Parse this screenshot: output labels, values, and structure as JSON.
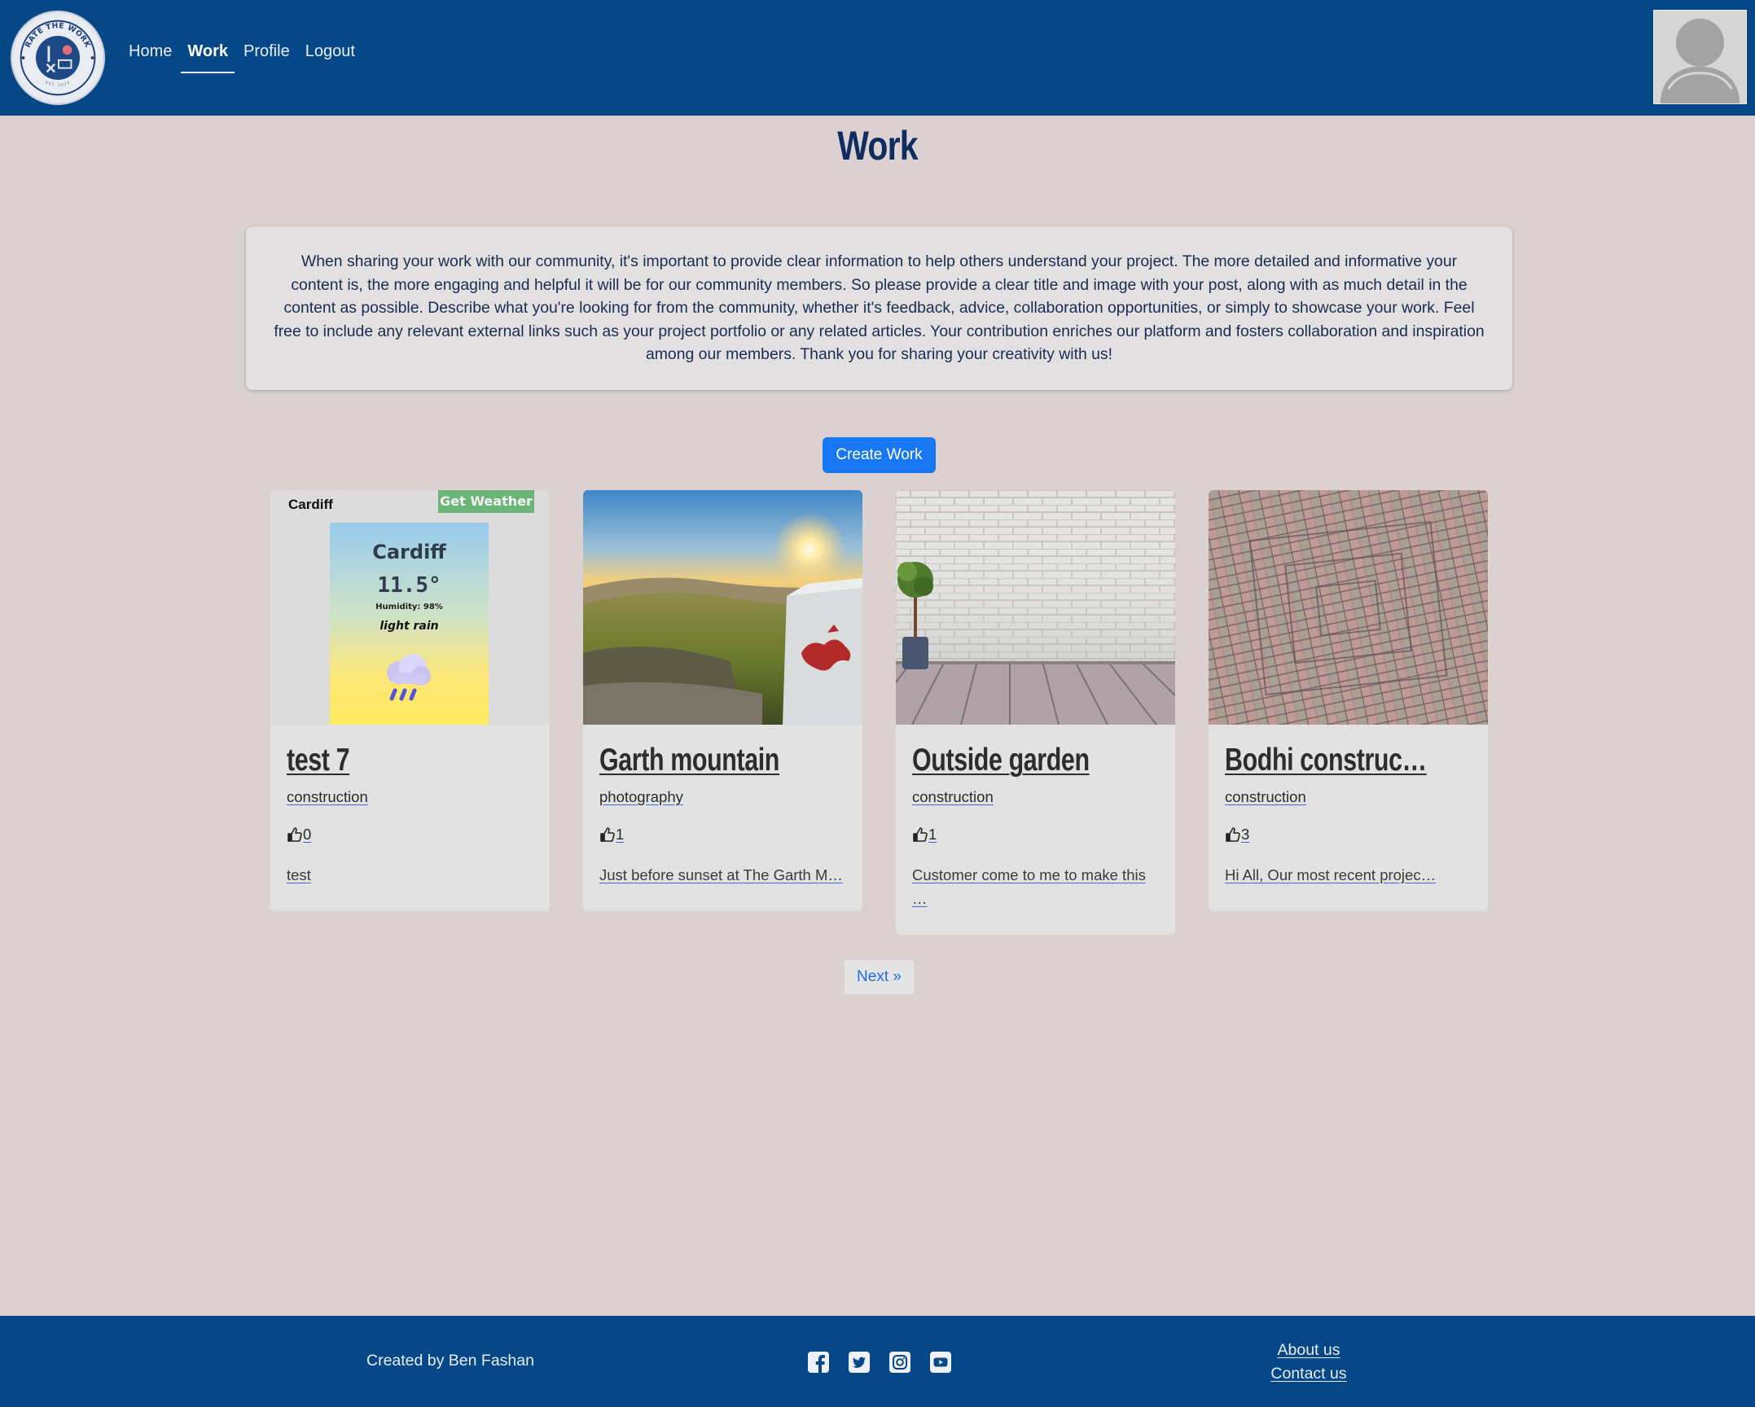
{
  "logo": {
    "text_top": "RATE THE WORK",
    "text_bottom": "EST. 2024"
  },
  "nav": {
    "items": [
      {
        "label": "Home"
      },
      {
        "label": "Work"
      },
      {
        "label": "Profile"
      },
      {
        "label": "Logout"
      }
    ],
    "active": "Work"
  },
  "page": {
    "title": "Work",
    "intro": "When sharing your work with our community, it's important to provide clear information to help others understand your project. The more detailed and informative your content is, the more engaging and helpful it will be for our community members. So please provide a clear title and image with your post, along with as much detail in the content as possible. Describe what you're looking for from the community, whether it's feedback, advice, collaboration opportunities, or simply to showcase your work. Feel free to include any relevant external links such as your project portfolio or any related articles. Your contribution enriches our platform and fosters collaboration and inspiration among our members. Thank you for sharing your creativity with us!",
    "create_button": "Create Work",
    "next_button": "Next »"
  },
  "cards": [
    {
      "title": "test 7",
      "category": "construction",
      "likes": "0",
      "excerpt": "test",
      "media": "weather-widget",
      "weather": {
        "label": "Cardiff",
        "button": "Get Weather",
        "city": "Cardiff",
        "temp": "11.5°",
        "humidity": "Humidity: 98%",
        "description": "light rain",
        "icon": "rain-cloud-icon"
      }
    },
    {
      "title": "Garth mountain",
      "category": "photography",
      "likes": "1",
      "excerpt": "Just before sunset at The Garth M…",
      "media": "sunset-mountain-photo"
    },
    {
      "title": "Outside garden",
      "category": "construction",
      "likes": "1",
      "excerpt": "Customer come to me to make this …",
      "media": "brick-wall-deck-photo"
    },
    {
      "title": "Bodhi construc…",
      "category": "construction",
      "likes": "3",
      "excerpt": "Hi All, Our most recent projec…",
      "media": "brick-paving-photo"
    }
  ],
  "footer": {
    "credit": "Created by Ben Fashan",
    "socials": [
      "facebook-icon",
      "twitter-icon",
      "instagram-icon",
      "youtube-icon"
    ],
    "links": [
      {
        "label": "About us"
      },
      {
        "label": "Contact us"
      }
    ]
  },
  "colors": {
    "header_bg": "#064887",
    "page_bg": "#dbd1d1",
    "title": "#0e2d5e",
    "primary_button": "#1877f2",
    "weather_button": "#6bb578"
  }
}
